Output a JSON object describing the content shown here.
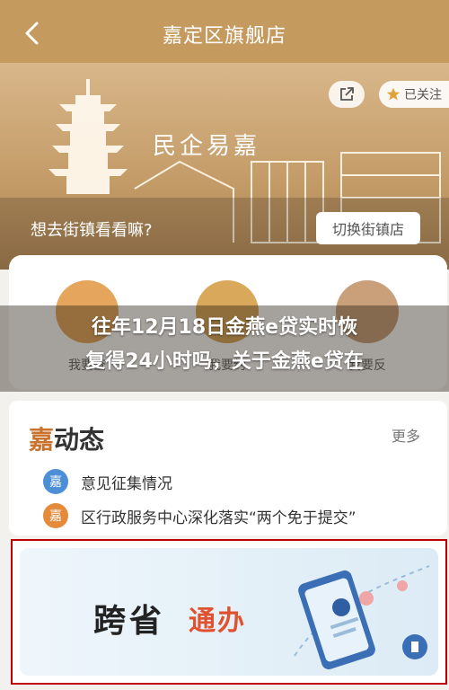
{
  "header": {
    "title": "嘉定区旗舰店",
    "back_icon": "chevron-left-icon"
  },
  "banner": {
    "logo_text": "民企易嘉",
    "share_icon": "share-icon",
    "follow_label": "已关注",
    "follow_icon": "star-icon",
    "prompt": "想去街镇看看嘛?",
    "switch_label": "切换街镇店"
  },
  "services": [
    {
      "label": "我要查",
      "color": "#e6a55c"
    },
    {
      "label": "我要约",
      "color": "#d9a85a"
    },
    {
      "label": "我要反",
      "color": "#c9a07a"
    }
  ],
  "headline": {
    "line1": "往年12月18日金燕e贷实时恢",
    "line2": "复得24小时吗，关于金燕e贷在"
  },
  "news": {
    "title_jia": "嘉",
    "title_rest": "动态",
    "more_label": "更多",
    "items": [
      {
        "badge": "嘉",
        "badge_color": "#4c8fd6",
        "text": "意见征集情况"
      },
      {
        "badge": "嘉",
        "badge_color": "#e58a3a",
        "text": "区行政服务中心深化落实“两个免于提交”"
      }
    ]
  },
  "promo": {
    "text_a": "跨省",
    "text_b": "通办"
  },
  "colors": {
    "brand": "#c59a5f",
    "accent": "#c9732e",
    "highlight_border": "#c00000"
  }
}
